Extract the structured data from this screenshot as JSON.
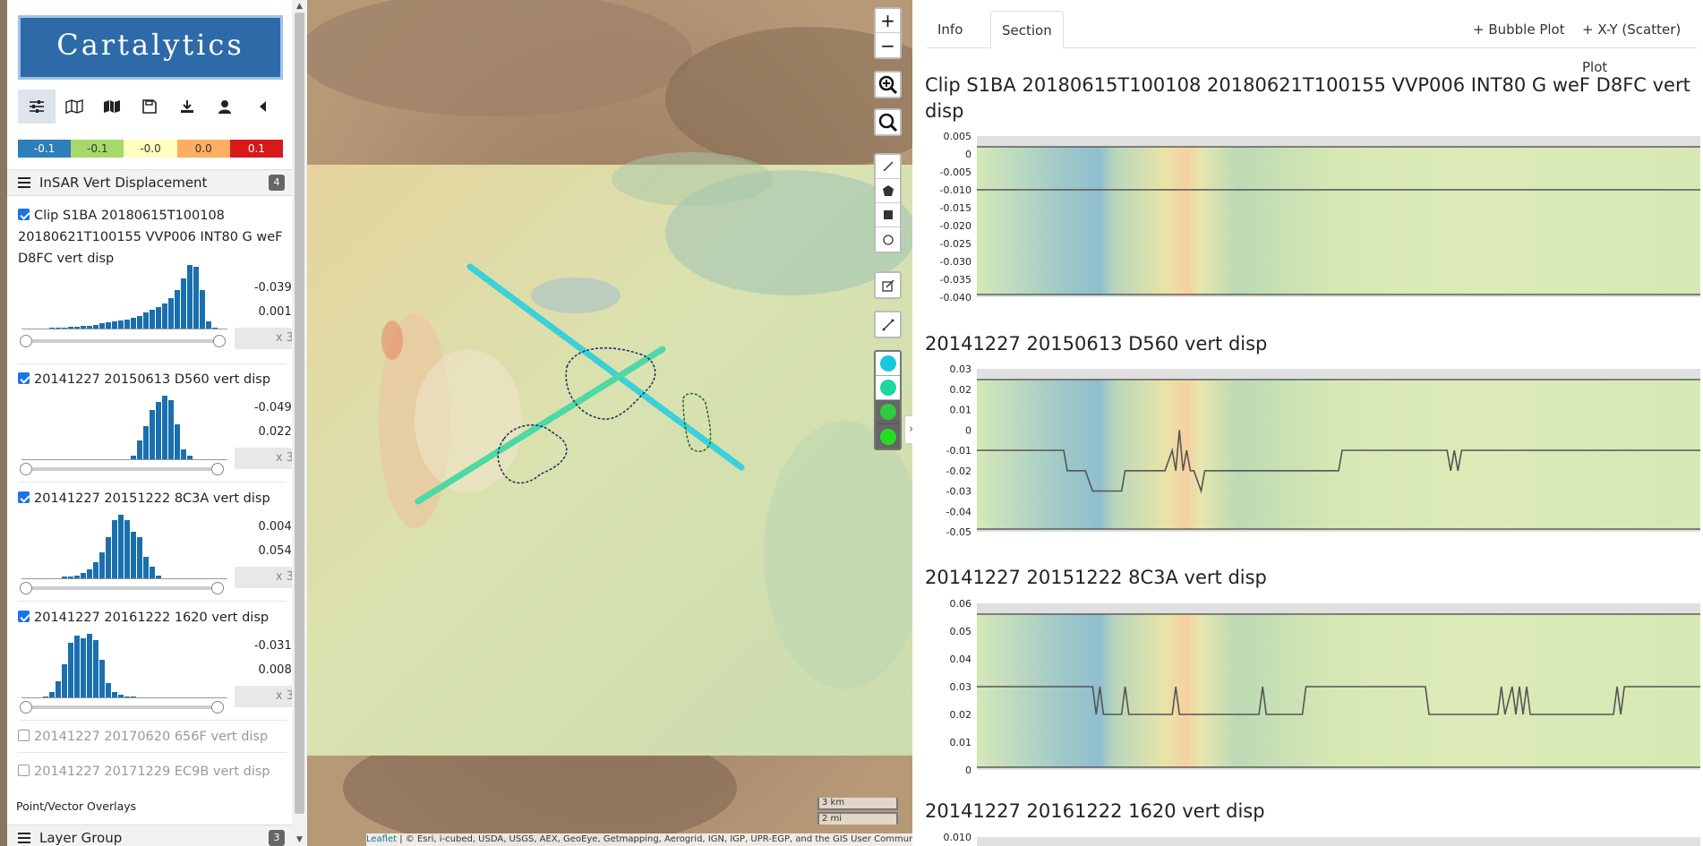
{
  "app": {
    "name": "Cartalytics"
  },
  "legend": {
    "items": [
      {
        "label": "-0.1",
        "color": "#2c7fb8"
      },
      {
        "label": "-0.1",
        "color": "#a6d96a"
      },
      {
        "label": "-0.0",
        "color": "#ffffbf"
      },
      {
        "label": "0.0",
        "color": "#fdae61"
      },
      {
        "label": "0.1",
        "color": "#d7191c"
      }
    ]
  },
  "toolbar": {
    "icons": [
      "sliders-icon",
      "map-outline-icon",
      "map-filled-icon",
      "save-icon",
      "download-icon",
      "user-icon",
      "collapse-left-icon"
    ]
  },
  "section": {
    "title": "InSAR Vert Displacement",
    "count": "4"
  },
  "layers": [
    {
      "title": "Clip S1BA 20180615T100108 20180621T100155 VVP006 INT80 G weF D8FC vert disp",
      "min": "-0.0396",
      "max": "0.0012",
      "multiplier": "x 3",
      "hist": [
        1,
        1,
        1,
        2,
        2,
        2,
        3,
        3,
        4,
        4,
        5,
        6,
        7,
        8,
        9,
        10,
        12,
        14,
        17,
        20,
        23,
        27,
        32,
        40,
        52,
        66,
        64,
        40,
        8,
        2
      ]
    },
    {
      "title": "20141227 20150613 D560 vert disp",
      "min": "-0.0495",
      "max": "0.0229",
      "multiplier": "x 3",
      "hist": [
        0,
        0,
        0,
        0,
        0,
        0,
        0,
        0,
        0,
        0,
        0,
        0,
        0,
        0,
        1,
        1,
        4,
        18,
        31,
        45,
        52,
        58,
        54,
        32,
        10,
        4,
        1,
        1,
        0,
        0
      ]
    },
    {
      "title": "20141227 20151222 8C3A vert disp",
      "min": "0.0043",
      "max": "0.0548",
      "multiplier": "x 3",
      "hist": [
        1,
        1,
        1,
        1,
        1,
        2,
        2,
        3,
        5,
        8,
        14,
        22,
        34,
        48,
        52,
        48,
        38,
        34,
        18,
        10,
        3,
        1,
        1,
        1,
        0,
        0,
        0,
        0,
        0,
        0
      ]
    },
    {
      "title": "20141227 20161222 1620 vert disp",
      "min": "-0.0319",
      "max": "0.0087",
      "multiplier": "x 3",
      "hist": [
        1,
        1,
        2,
        6,
        16,
        32,
        52,
        58,
        56,
        60,
        54,
        36,
        14,
        6,
        3,
        2,
        2,
        1,
        1,
        1,
        1,
        1,
        1,
        1,
        1,
        1,
        1,
        1,
        1,
        1
      ]
    }
  ],
  "inactive_layers": [
    "20141227 20170620 656F vert disp",
    "20141227 20171229 EC9B vert disp"
  ],
  "point_vector_label": "Point/Vector Overlays",
  "layer_group": {
    "title": "Layer Group",
    "count": "3"
  },
  "map": {
    "controls": [
      "zoom-in-icon",
      "zoom-out-icon",
      "zoom-box-icon",
      "search-icon",
      "draw-line-icon",
      "draw-polygon-icon",
      "draw-rectangle-icon",
      "draw-circle-icon",
      "edit-icon",
      "measure-icon"
    ],
    "zoom_in": "+",
    "zoom_out": "−",
    "color_swatches": [
      "#17c8dc",
      "#1ed6a0",
      "#2ecc40",
      "#22dd22"
    ],
    "attribution_link": "Leaflet",
    "attribution_text": " | © Esri, i-cubed, USDA, USGS, AEX, GeoEye, Getmapping, Aerogrid, IGN, IGP, UPR-EGP, and the GIS User Community",
    "scale_km": "3 km",
    "scale_mi": "2 mi",
    "collapse_glyph": "»"
  },
  "right_panel": {
    "tabs": [
      "Info",
      "Section"
    ],
    "active_tab": "Section",
    "buttons": [
      "+ Bubble Plot",
      "+ X-Y (Scatter) Plot"
    ]
  },
  "chart_data": [
    {
      "type": "line",
      "title": "Clip S1BA 20180615T100108 20180621T100155 VVP006 INT80 G weF D8FC vert disp",
      "ylim": [
        -0.04,
        0.005
      ],
      "yticks": [
        "0.005",
        "0",
        "-0.005",
        "-0.010",
        "-0.015",
        "-0.020",
        "-0.025",
        "-0.030",
        "-0.035",
        "-0.040"
      ],
      "x": [
        0,
        1
      ],
      "y": [
        -0.01,
        -0.01
      ]
    },
    {
      "type": "line",
      "title": "20141227 20150613 D560 vert disp",
      "ylim": [
        -0.05,
        0.03
      ],
      "yticks": [
        "0.03",
        "0.02",
        "0.01",
        "0",
        "-0.01",
        "-0.02",
        "-0.03",
        "-0.04",
        "-0.05"
      ],
      "x": [
        0,
        0.12,
        0.125,
        0.15,
        0.16,
        0.165,
        0.2,
        0.205,
        0.215,
        0.22,
        0.225,
        0.26,
        0.27,
        0.275,
        0.28,
        0.285,
        0.29,
        0.295,
        0.3,
        0.31,
        0.315,
        0.32,
        0.5,
        0.505,
        0.65,
        0.655,
        0.66,
        0.665,
        0.67,
        0.675,
        1
      ],
      "y": [
        -0.01,
        -0.01,
        -0.02,
        -0.02,
        -0.03,
        -0.03,
        -0.03,
        -0.02,
        -0.02,
        -0.02,
        -0.02,
        -0.02,
        -0.01,
        -0.02,
        0,
        -0.02,
        -0.01,
        -0.02,
        -0.02,
        -0.03,
        -0.02,
        -0.02,
        -0.02,
        -0.01,
        -0.01,
        -0.02,
        -0.01,
        -0.02,
        -0.01,
        -0.01,
        -0.01
      ]
    },
    {
      "type": "line",
      "title": "20141227 20151222 8C3A vert disp",
      "ylim": [
        0,
        0.06
      ],
      "yticks": [
        "0.06",
        "0.05",
        "0.04",
        "0.03",
        "0.02",
        "0.01",
        "0"
      ],
      "x": [
        0,
        0.16,
        0.165,
        0.17,
        0.175,
        0.18,
        0.2,
        0.205,
        0.21,
        0.215,
        0.27,
        0.275,
        0.28,
        0.285,
        0.39,
        0.395,
        0.4,
        0.405,
        0.45,
        0.455,
        0.62,
        0.625,
        0.63,
        0.635,
        0.72,
        0.725,
        0.73,
        0.74,
        0.745,
        0.75,
        0.755,
        0.76,
        0.765,
        0.77,
        0.88,
        0.885,
        0.89,
        0.895,
        1
      ],
      "y": [
        0.03,
        0.03,
        0.02,
        0.03,
        0.02,
        0.02,
        0.02,
        0.03,
        0.02,
        0.02,
        0.02,
        0.03,
        0.02,
        0.02,
        0.02,
        0.03,
        0.02,
        0.02,
        0.02,
        0.03,
        0.03,
        0.02,
        0.02,
        0.02,
        0.02,
        0.03,
        0.02,
        0.03,
        0.02,
        0.03,
        0.02,
        0.03,
        0.02,
        0.02,
        0.02,
        0.03,
        0.02,
        0.03,
        0.03
      ]
    },
    {
      "type": "line",
      "title": "20141227 20161222 1620 vert disp",
      "ylim": [
        0,
        0.01
      ],
      "yticks": [
        "0.010"
      ],
      "x": [],
      "y": []
    }
  ]
}
